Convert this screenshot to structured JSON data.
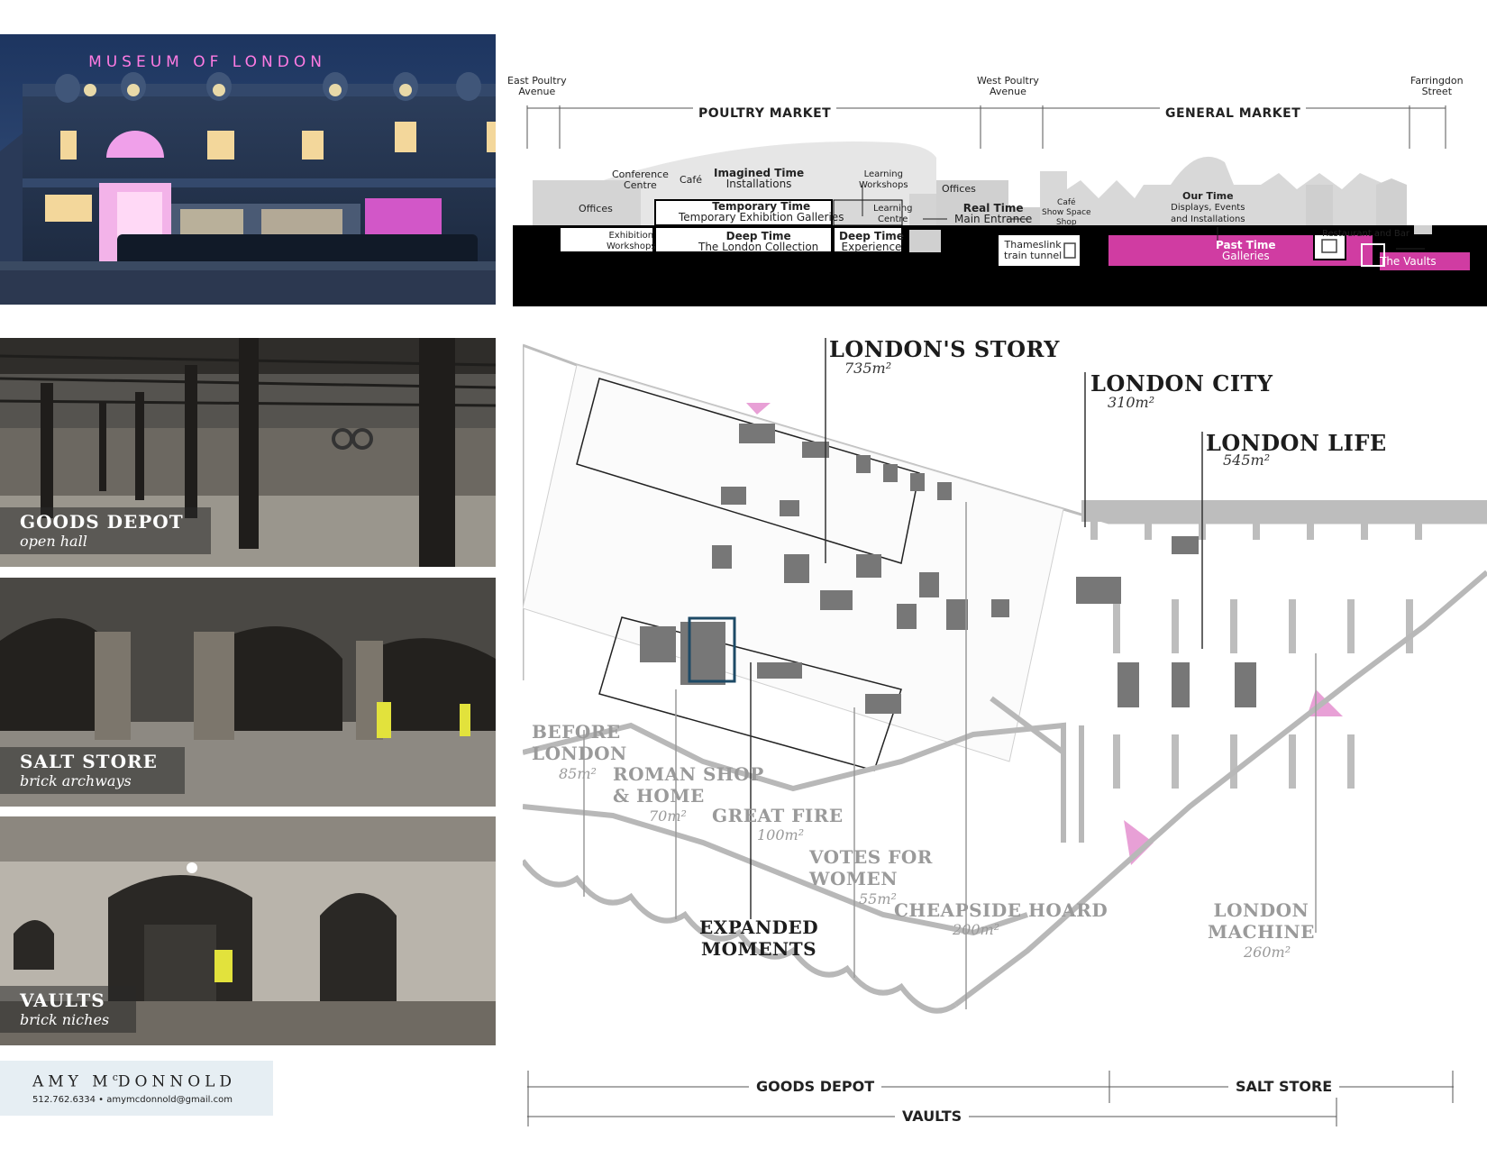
{
  "photos": [
    {
      "id": "exterior",
      "sign": "MUSEUM OF LONDON"
    },
    {
      "id": "goods-depot",
      "title": "GOODS DEPOT",
      "subtitle": "open hall"
    },
    {
      "id": "salt-store",
      "title": "SALT STORE",
      "subtitle": "brick archways"
    },
    {
      "id": "vaults",
      "title": "VAULTS",
      "subtitle": "brick niches"
    }
  ],
  "contact": {
    "name": "AMY McDONNOLD",
    "name_main1": "AMY M",
    "name_sup": "c",
    "name_main2": "DONNOLD",
    "details": "512.762.6334 • amymcdonnold@gmail.com"
  },
  "section": {
    "streets": {
      "east_poultry": [
        "East Poultry",
        "Avenue"
      ],
      "west_poultry": [
        "West Poultry",
        "Avenue"
      ],
      "farringdon": [
        "Farringdon",
        "Street"
      ]
    },
    "markets": {
      "poultry": "POULTRY MARKET",
      "general": "GENERAL MARKET"
    },
    "labels": {
      "conference": [
        "Conference",
        "Centre"
      ],
      "cafe": "Café",
      "imagined_title": "Imagined Time",
      "imagined_sub": "Installations",
      "learning_workshops": [
        "Learning",
        "Workshops"
      ],
      "offices_left": "Offices",
      "offices_mid": "Offices",
      "temporary_title": "Temporary Time",
      "temporary_sub": "Temporary Exhibition Galleries",
      "learning_centre": [
        "Learning",
        "Centre"
      ],
      "real_title": "Real Time",
      "real_sub": "Main Entrance",
      "cafe_shop": [
        "Café",
        "Show Space",
        "Shop"
      ],
      "our_title": "Our Time",
      "our_sub": [
        "Displays, Events",
        "and Installations"
      ],
      "restaurant": "Restaurant and Bar",
      "exhibition_workshops": [
        "Exhibition",
        "Workshops"
      ],
      "deep_collection_title": "Deep Time",
      "deep_collection_sub": "The London Collection",
      "deep_experience_title": "Deep Time",
      "deep_experience_sub": "Experience",
      "thameslink": [
        "Thameslink",
        "train tunnel"
      ],
      "past_title": "Past Time",
      "past_sub": "Galleries",
      "vaults": "The Vaults"
    },
    "colors": {
      "accent": "#d03ca2",
      "ground": "#000000",
      "building": "#d8d8d8"
    }
  },
  "plan": {
    "zones": [
      {
        "id": "londons-story",
        "name": "LONDON'S STORY",
        "area": "735m²"
      },
      {
        "id": "london-city",
        "name": "LONDON CITY",
        "area": "310m²"
      },
      {
        "id": "london-life",
        "name": "LONDON LIFE",
        "area": "545m²"
      },
      {
        "id": "before-london",
        "name": [
          "BEFORE",
          "LONDON"
        ],
        "area": "85m²"
      },
      {
        "id": "roman-shop",
        "name": [
          "ROMAN SHOP",
          "& HOME"
        ],
        "area": "70m²"
      },
      {
        "id": "great-fire",
        "name": "GREAT FIRE",
        "area": "100m²"
      },
      {
        "id": "votes-for-women",
        "name": [
          "VOTES FOR",
          "WOMEN"
        ],
        "area": "55m²"
      },
      {
        "id": "cheapside-hoard",
        "name": "CHEAPSIDE HOARD",
        "area": "200m²"
      },
      {
        "id": "expanded-moments",
        "name": [
          "EXPANDED",
          "MOMENTS"
        ]
      },
      {
        "id": "london-machine",
        "name": [
          "LONDON",
          "MACHINE"
        ],
        "area": "260m²"
      }
    ],
    "bars": {
      "goods_depot": "GOODS DEPOT",
      "salt_store": "SALT STORE",
      "vaults": "VAULTS"
    }
  }
}
